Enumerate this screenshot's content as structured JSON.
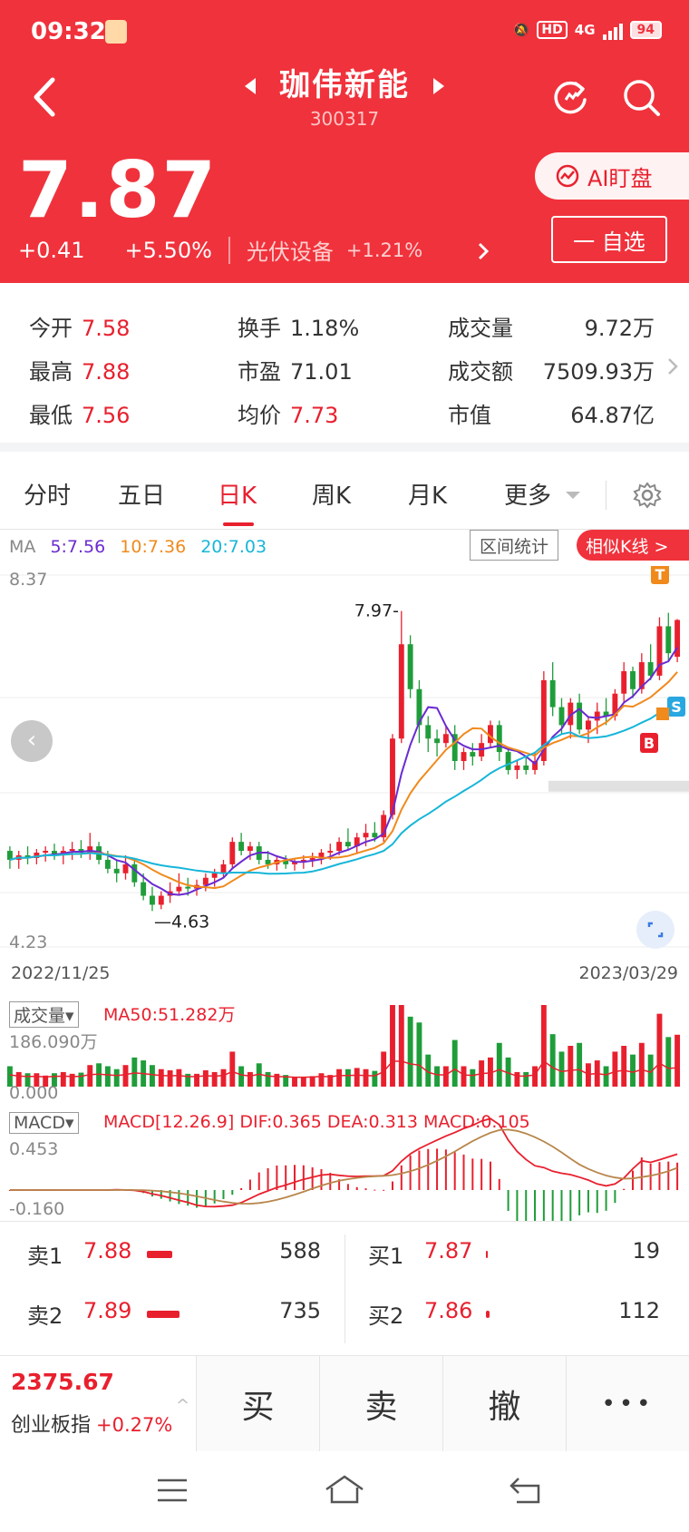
{
  "status": {
    "time": "09:32",
    "network": "4G",
    "hd": "HD",
    "battery": "94"
  },
  "header": {
    "stock_name": "珈伟新能",
    "stock_code": "300317",
    "price": "7.87",
    "change": "+0.41",
    "change_pct": "+5.50%",
    "sector_name": "光伏设备",
    "sector_change": "+1.21%",
    "ai_label": "AI盯盘",
    "watchlist_label": "一 自选"
  },
  "stats": {
    "open_label": "今开",
    "open": "7.58",
    "high_label": "最高",
    "high": "7.88",
    "low_label": "最低",
    "low": "7.56",
    "turnover_label": "换手",
    "turnover": "1.18%",
    "pe_label": "市盈",
    "pe": "71.01",
    "avg_label": "均价",
    "avg": "7.73",
    "volume_label": "成交量",
    "volume": "9.72万",
    "amount_label": "成交额",
    "amount": "7509.93万",
    "mktcap_label": "市值",
    "mktcap": "64.87亿"
  },
  "tabs": [
    "分时",
    "五日",
    "日K",
    "周K",
    "月K",
    "更多"
  ],
  "chart": {
    "ma_label": "MA",
    "ma5": "5:7.56",
    "ma10": "10:7.36",
    "ma20": "20:7.03",
    "range_stats": "区间统计",
    "similar_k": "相似K线 >",
    "y_max": "8.37",
    "y_min": "4.23",
    "peak_label": "7.97",
    "trough_label": "4.63",
    "date_start": "2022/11/25",
    "date_end": "2023/03/29",
    "vol_label": "成交量▾",
    "vol_ma": "MA50:51.282万",
    "vol_max": "186.090万",
    "vol_min": "0.000",
    "macd_label": "MACD▾",
    "macd_params": "MACD[12.26.9] DIF:0.365  DEA:0.313  MACD:0.105",
    "macd_max": "0.453",
    "macd_min": "-0.160",
    "marker_t": "T",
    "marker_s": "S",
    "marker_b": "B",
    "colors": {
      "up": "#e8202e",
      "down": "#1f9d3a",
      "ma5": "#6a2bd1",
      "ma10": "#f08a1c",
      "ma20": "#16b6d9"
    }
  },
  "chart_data": {
    "type": "candlestick",
    "x_start": "2022/11/25",
    "x_end": "2023/03/29",
    "ylim": [
      4.23,
      8.37
    ],
    "ohlc": [
      [
        5.3,
        5.35,
        5.1,
        5.2
      ],
      [
        5.2,
        5.3,
        5.1,
        5.25
      ],
      [
        5.25,
        5.35,
        5.15,
        5.22
      ],
      [
        5.22,
        5.32,
        5.15,
        5.28
      ],
      [
        5.28,
        5.35,
        5.18,
        5.3
      ],
      [
        5.3,
        5.38,
        5.2,
        5.25
      ],
      [
        5.25,
        5.35,
        5.15,
        5.3
      ],
      [
        5.3,
        5.4,
        5.2,
        5.32
      ],
      [
        5.32,
        5.42,
        5.22,
        5.28
      ],
      [
        5.28,
        5.5,
        5.2,
        5.35
      ],
      [
        5.35,
        5.4,
        5.15,
        5.2
      ],
      [
        5.2,
        5.3,
        5.05,
        5.1
      ],
      [
        5.1,
        5.2,
        4.95,
        5.05
      ],
      [
        5.05,
        5.25,
        4.98,
        5.15
      ],
      [
        5.15,
        5.2,
        4.9,
        4.95
      ],
      [
        4.95,
        5.05,
        4.75,
        4.8
      ],
      [
        4.8,
        4.9,
        4.63,
        4.7
      ],
      [
        4.7,
        4.85,
        4.65,
        4.8
      ],
      [
        4.8,
        4.95,
        4.72,
        4.85
      ],
      [
        4.85,
        5.05,
        4.8,
        4.9
      ],
      [
        4.9,
        5.0,
        4.8,
        4.88
      ],
      [
        4.88,
        4.98,
        4.8,
        4.92
      ],
      [
        4.92,
        5.05,
        4.85,
        5.0
      ],
      [
        5.0,
        5.1,
        4.9,
        5.05
      ],
      [
        5.05,
        5.2,
        5.0,
        5.15
      ],
      [
        5.15,
        5.45,
        5.1,
        5.4
      ],
      [
        5.4,
        5.5,
        5.25,
        5.3
      ],
      [
        5.3,
        5.4,
        5.2,
        5.35
      ],
      [
        5.35,
        5.4,
        5.15,
        5.2
      ],
      [
        5.2,
        5.3,
        5.1,
        5.15
      ],
      [
        5.15,
        5.25,
        5.08,
        5.2
      ],
      [
        5.2,
        5.25,
        5.1,
        5.15
      ],
      [
        5.15,
        5.22,
        5.08,
        5.18
      ],
      [
        5.18,
        5.25,
        5.1,
        5.2
      ],
      [
        5.2,
        5.28,
        5.12,
        5.22
      ],
      [
        5.22,
        5.32,
        5.15,
        5.28
      ],
      [
        5.28,
        5.38,
        5.2,
        5.3
      ],
      [
        5.3,
        5.45,
        5.25,
        5.4
      ],
      [
        5.4,
        5.55,
        5.3,
        5.35
      ],
      [
        5.35,
        5.5,
        5.28,
        5.45
      ],
      [
        5.45,
        5.6,
        5.35,
        5.5
      ],
      [
        5.5,
        5.62,
        5.4,
        5.45
      ],
      [
        5.45,
        5.75,
        5.4,
        5.7
      ],
      [
        5.7,
        6.6,
        5.65,
        6.55
      ],
      [
        6.55,
        7.97,
        6.5,
        7.6
      ],
      [
        7.6,
        7.7,
        7.0,
        7.1
      ],
      [
        7.1,
        7.2,
        6.5,
        6.7
      ],
      [
        6.7,
        6.8,
        6.4,
        6.55
      ],
      [
        6.55,
        6.65,
        6.35,
        6.5
      ],
      [
        6.5,
        6.7,
        6.45,
        6.6
      ],
      [
        6.6,
        6.7,
        6.2,
        6.3
      ],
      [
        6.3,
        6.45,
        6.2,
        6.4
      ],
      [
        6.4,
        6.5,
        6.25,
        6.35
      ],
      [
        6.35,
        6.6,
        6.3,
        6.5
      ],
      [
        6.5,
        6.75,
        6.45,
        6.7
      ],
      [
        6.7,
        6.75,
        6.3,
        6.4
      ],
      [
        6.4,
        6.45,
        6.15,
        6.2
      ],
      [
        6.2,
        6.3,
        6.1,
        6.25
      ],
      [
        6.25,
        6.35,
        6.15,
        6.2
      ],
      [
        6.2,
        6.4,
        6.15,
        6.3
      ],
      [
        6.3,
        7.3,
        6.25,
        7.2
      ],
      [
        7.2,
        7.4,
        6.8,
        6.9
      ],
      [
        6.9,
        7.0,
        6.6,
        6.7
      ],
      [
        6.7,
        7.0,
        6.55,
        6.95
      ],
      [
        6.95,
        7.05,
        6.6,
        6.65
      ],
      [
        6.65,
        6.8,
        6.5,
        6.75
      ],
      [
        6.75,
        6.95,
        6.6,
        6.85
      ],
      [
        6.85,
        7.0,
        6.7,
        6.8
      ],
      [
        6.8,
        7.1,
        6.75,
        7.05
      ],
      [
        7.05,
        7.4,
        6.95,
        7.3
      ],
      [
        7.3,
        7.35,
        7.0,
        7.1
      ],
      [
        7.1,
        7.5,
        7.05,
        7.4
      ],
      [
        7.4,
        7.6,
        7.2,
        7.25
      ],
      [
        7.25,
        7.9,
        7.2,
        7.8
      ],
      [
        7.8,
        7.95,
        7.4,
        7.5
      ],
      [
        7.46,
        7.88,
        7.4,
        7.87
      ]
    ]
  },
  "orderbook": {
    "asks": [
      {
        "label": "卖1",
        "price": "7.88",
        "vol": "588"
      },
      {
        "label": "卖2",
        "price": "7.89",
        "vol": "735"
      }
    ],
    "bids": [
      {
        "label": "买1",
        "price": "7.87",
        "vol": "19"
      },
      {
        "label": "买2",
        "price": "7.86",
        "vol": "112"
      }
    ]
  },
  "bottom": {
    "index_value": "2375.67",
    "index_name": "创业板指",
    "index_change": "+0.27%",
    "buy": "买",
    "sell": "卖",
    "cancel": "撤",
    "more": "•••"
  }
}
